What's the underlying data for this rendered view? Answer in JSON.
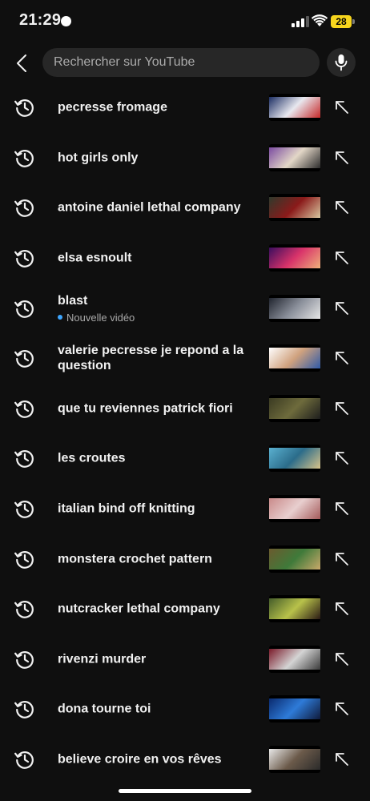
{
  "status_bar": {
    "time": "21:29",
    "battery": "28"
  },
  "search": {
    "placeholder": "Rechercher sur YouTube"
  },
  "suggestions": [
    {
      "query": "pecresse fromage",
      "thumb": [
        "#1c2e63",
        "#e8e8ef",
        "#c62828"
      ]
    },
    {
      "query": "hot girls only",
      "thumb": [
        "#7a4aa0",
        "#e3d7c7",
        "#2b2b2b"
      ]
    },
    {
      "query": "antoine daniel lethal company",
      "thumb": [
        "#2f3a2c",
        "#8b1a1a",
        "#d8c7a0"
      ]
    },
    {
      "query": "elsa esnoult",
      "thumb": [
        "#3a0d5e",
        "#d9336a",
        "#f0b07a"
      ]
    },
    {
      "query": "blast",
      "subtitle": "Nouvelle vidéo",
      "thumb": [
        "#20242e",
        "#8a8f9a",
        "#e7e7e7"
      ]
    },
    {
      "query": "valerie pecresse je repond a la question",
      "thumb": [
        "#ffffff",
        "#d0a27e",
        "#2f5aa8"
      ]
    },
    {
      "query": "que tu reviennes patrick fiori",
      "thumb": [
        "#3a3a22",
        "#6e6b3c",
        "#1d1d1d"
      ]
    },
    {
      "query": "les croutes",
      "thumb": [
        "#5ab0d0",
        "#2b6c8a",
        "#d8c48a"
      ]
    },
    {
      "query": "italian bind off knitting",
      "thumb": [
        "#c98a8a",
        "#e8cfcf",
        "#a45a5a"
      ]
    },
    {
      "query": "monstera crochet pattern",
      "thumb": [
        "#6b5a2e",
        "#3f7a3a",
        "#c9a96a"
      ]
    },
    {
      "query": "nutcracker lethal company",
      "thumb": [
        "#445c2a",
        "#b8c24a",
        "#2a1a14"
      ]
    },
    {
      "query": "rivenzi murder",
      "thumb": [
        "#7a1a2a",
        "#d4d4d4",
        "#3a3a3a"
      ]
    },
    {
      "query": "dona tourne toi",
      "thumb": [
        "#0a2a6e",
        "#2e7bd8",
        "#0f1a3a"
      ]
    },
    {
      "query": "believe croire en vos rêves",
      "thumb": [
        "#e8e8e8",
        "#6b5a4a",
        "#2a2a2a"
      ]
    }
  ]
}
